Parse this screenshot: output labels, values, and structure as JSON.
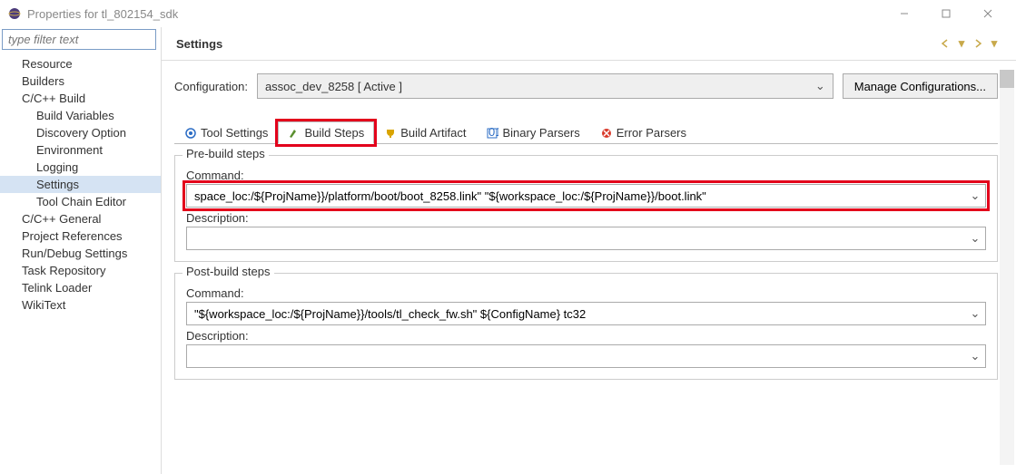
{
  "window": {
    "title": "Properties for tl_802154_sdk"
  },
  "sidebar": {
    "filter_placeholder": "type filter text",
    "items": [
      {
        "label": "Resource",
        "level": 0
      },
      {
        "label": "Builders",
        "level": 0
      },
      {
        "label": "C/C++ Build",
        "level": 0
      },
      {
        "label": "Build Variables",
        "level": 1
      },
      {
        "label": "Discovery Option",
        "level": 1
      },
      {
        "label": "Environment",
        "level": 1
      },
      {
        "label": "Logging",
        "level": 1
      },
      {
        "label": "Settings",
        "level": 1,
        "selected": true
      },
      {
        "label": "Tool Chain Editor",
        "level": 1
      },
      {
        "label": "C/C++ General",
        "level": 0
      },
      {
        "label": "Project References",
        "level": 0
      },
      {
        "label": "Run/Debug Settings",
        "level": 0
      },
      {
        "label": "Task Repository",
        "level": 0
      },
      {
        "label": "Telink Loader",
        "level": 0
      },
      {
        "label": "WikiText",
        "level": 0
      }
    ]
  },
  "page": {
    "title": "Settings",
    "config_label": "Configuration:",
    "config_value": "assoc_dev_8258  [ Active ]",
    "manage_btn": "Manage Configurations..."
  },
  "tabs": [
    {
      "label": "Tool Settings",
      "icon": "tool-settings-icon",
      "color": "#2b6cc4"
    },
    {
      "label": "Build Steps",
      "icon": "build-steps-icon",
      "color": "#5a8f2f",
      "active": true,
      "highlight": true
    },
    {
      "label": "Build Artifact",
      "icon": "trophy-icon",
      "color": "#d9a400"
    },
    {
      "label": "Binary Parsers",
      "icon": "binary-icon",
      "color": "#2b6cc4"
    },
    {
      "label": "Error Parsers",
      "icon": "error-icon",
      "color": "#d93a2b"
    }
  ],
  "prebuild": {
    "legend": "Pre-build steps",
    "command_label": "Command:",
    "command_value": "space_loc:/${ProjName}}/platform/boot/boot_8258.link\" \"${workspace_loc:/${ProjName}}/boot.link\"",
    "description_label": "Description:",
    "description_value": ""
  },
  "postbuild": {
    "legend": "Post-build steps",
    "command_label": "Command:",
    "command_value": "\"${workspace_loc:/${ProjName}}/tools/tl_check_fw.sh\" ${ConfigName} tc32",
    "description_label": "Description:",
    "description_value": ""
  },
  "icons": {
    "chevron_down": "⌄"
  }
}
